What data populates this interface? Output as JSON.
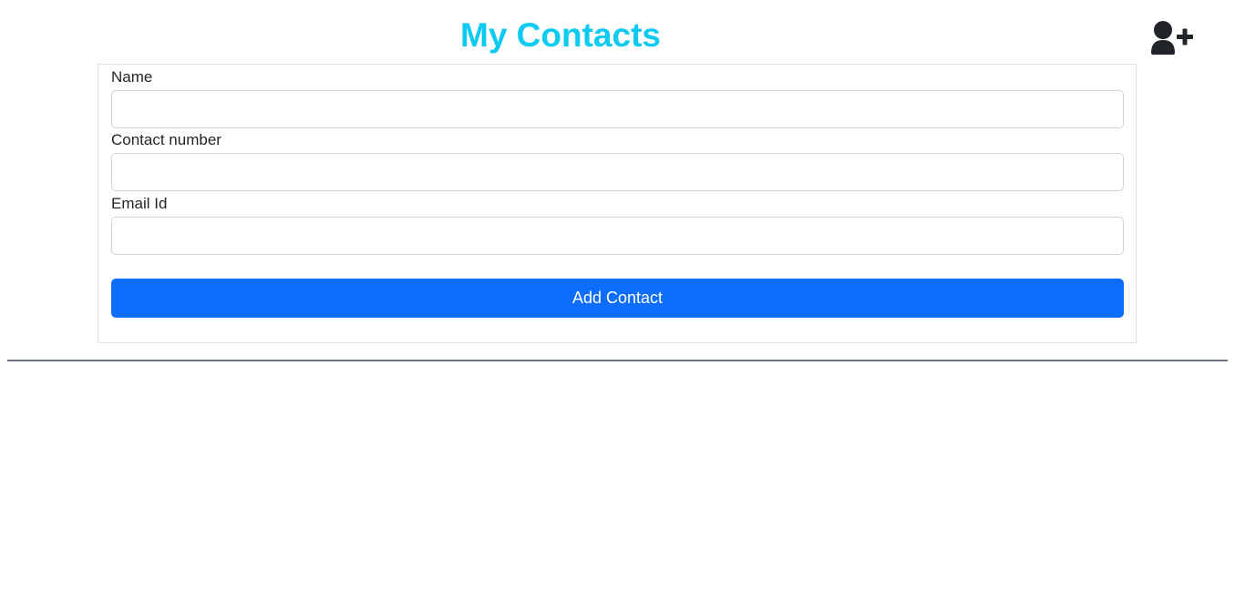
{
  "header": {
    "title": "My Contacts",
    "add_user_icon": "user-plus-icon"
  },
  "form": {
    "fields": [
      {
        "label": "Name",
        "value": "",
        "placeholder": ""
      },
      {
        "label": "Contact number",
        "value": "",
        "placeholder": ""
      },
      {
        "label": "Email Id",
        "value": "",
        "placeholder": ""
      }
    ],
    "submit_label": "Add Contact"
  },
  "colors": {
    "title": "#0dcaf0",
    "primary_button": "#0d6efd",
    "divider": "#6c757d",
    "icon": "#212529"
  }
}
